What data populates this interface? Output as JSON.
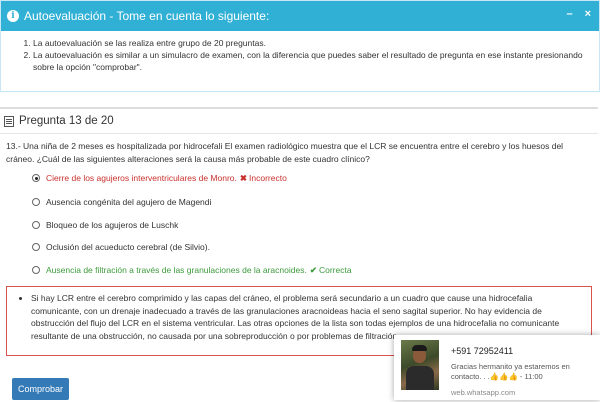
{
  "info_panel": {
    "title": "Autoevaluación - Tome en cuenta lo siguiente:",
    "minimize": "–",
    "close": "×",
    "items": [
      "La autoevaluación se las realiza entre grupo de 20 preguntas.",
      "La autoevaluación es similar a un simulacro de examen, con la diferencia que puedes saber el resultado de pregunta en ese instante presionando sobre la opción \"comprobar\"."
    ]
  },
  "question_panel": {
    "title": "Pregunta 13 de 20",
    "question": "13.- Una niña de 2 meses es hospitalizada por hidrocefali El examen radiológico muestra que el LCR se encuentra entre el cerebro y los huesos del cráneo. ¿Cuál de las siguientes alteraciones será la causa más probable de este cuadro clínico?",
    "options": [
      {
        "label": "Cierre de los agujeros interventriculares de Monro.",
        "status": "Incorrecto",
        "selected": true
      },
      {
        "label": "Ausencia congénita del agujero de Magendi",
        "status": "",
        "selected": false
      },
      {
        "label": "Bloqueo de los agujeros de Luschk",
        "status": "",
        "selected": false
      },
      {
        "label": "Oclusión del acueducto cerebral (de Silvio).",
        "status": "",
        "selected": false
      },
      {
        "label": "Ausencia de filtración a través de las granulaciones de la aracnoides.",
        "status": "Correcta",
        "selected": false
      }
    ],
    "explanation": "Si hay LCR entre el cerebro comprimido y las capas del cráneo, el problema será secundario a un cuadro que cause una hidrocefalia comunicante, con un drenaje inadecuado a través de las granulaciones aracnoideas hacia el seno sagital superior. No hay evidencia de obstrucción del flujo del LCR en el sistema ventricular. Las otras opciones de la lista son todas ejemplos de una hidrocefalia no comunicante resultante de una obstrucción, no causada por una sobreproducción o por problemas de filtración.",
    "button": "Comprobar"
  },
  "notification": {
    "phone": "+591 72952411",
    "message": "Gracias hermanito ya estaremos en contacto. . .👍👍👍 - 11:00",
    "source": "web.whatsapp.com"
  },
  "colors": {
    "info_header": "#31b0d5",
    "incorrect": "#c9302c",
    "correct": "#3c9a3c",
    "button": "#337ab7"
  }
}
